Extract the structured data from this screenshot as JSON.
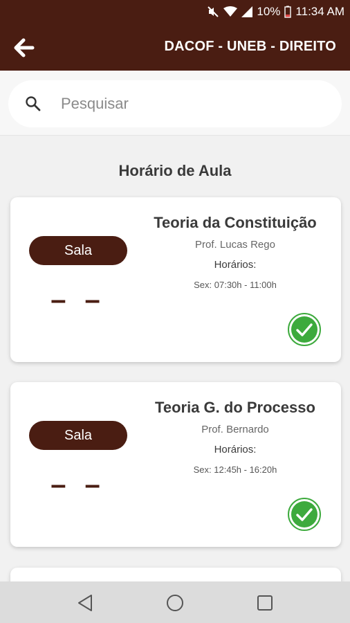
{
  "status_bar": {
    "battery": "10%",
    "time": "11:34 AM"
  },
  "app_bar": {
    "title": "DACOF - UNEB - DIREITO",
    "back_icon": "arrow-left-icon"
  },
  "search": {
    "placeholder": "Pesquisar",
    "value": ""
  },
  "section_title": "Horário de Aula",
  "colors": {
    "primary": "#4a1d12",
    "check": "#3daa3d"
  },
  "classes": [
    {
      "room_label": "Sala",
      "room": "– –",
      "subject": "Teoria da Constituição",
      "professor": "Prof. Lucas Rego",
      "hours_label": "Horários:",
      "schedule": "Sex: 07:30h - 11:00h",
      "status_icon": "check-circle-icon"
    },
    {
      "room_label": "Sala",
      "room": "– –",
      "subject": "Teoria G. do Processo",
      "professor": "Prof. Bernardo",
      "hours_label": "Horários:",
      "schedule": "Sex: 12:45h - 16:20h",
      "status_icon": "check-circle-icon"
    }
  ]
}
